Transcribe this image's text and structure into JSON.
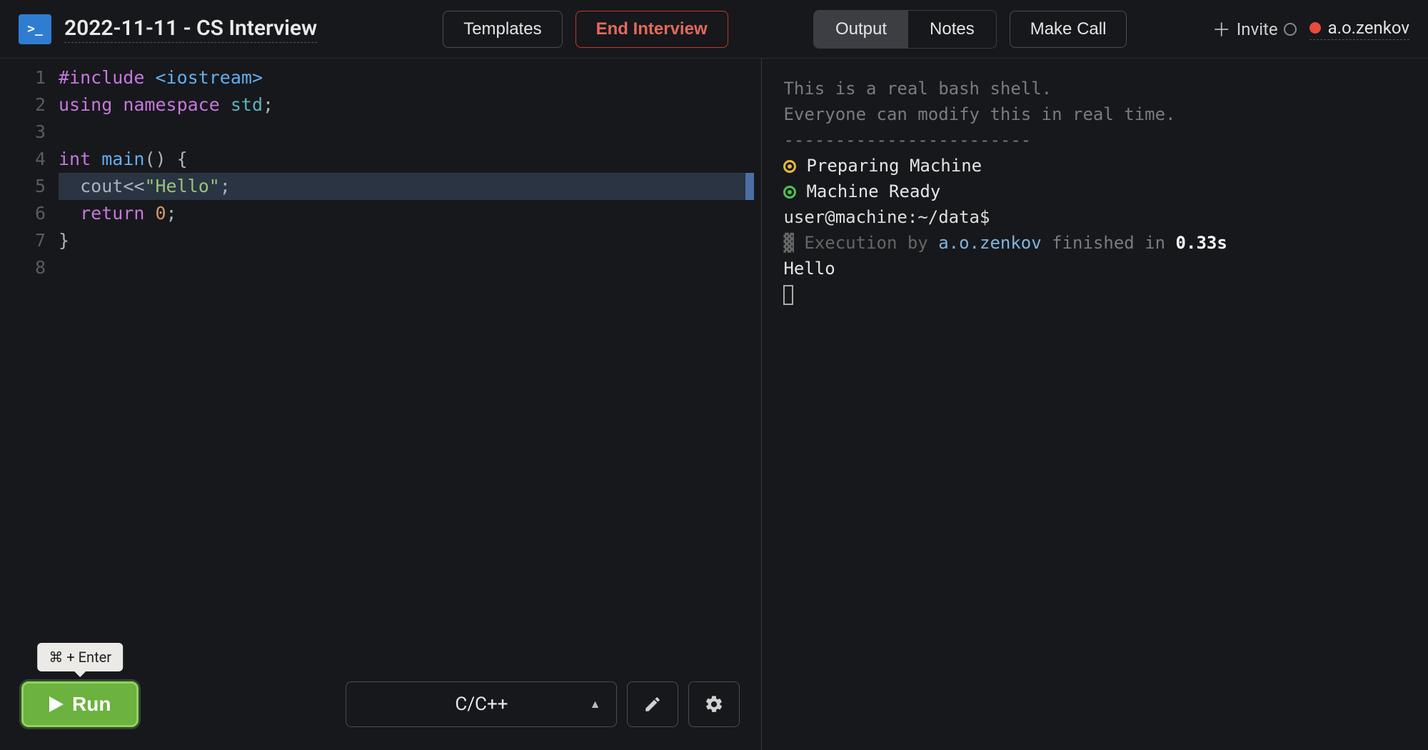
{
  "header": {
    "logo_text": ">_",
    "title": "2022-11-11 - CS Interview",
    "templates_label": "Templates",
    "end_label": "End Interview",
    "tabs": {
      "output": "Output",
      "notes": "Notes"
    },
    "make_call_label": "Make Call",
    "invite_label": "Invite",
    "username": "a.o.zenkov"
  },
  "editor": {
    "line_numbers": [
      "1",
      "2",
      "3",
      "4",
      "5",
      "6",
      "7",
      "8"
    ],
    "highlighted_line_index": 4,
    "tokens": {
      "l1_pp": "#include",
      "l1_inc": "<iostream>",
      "l2_kw": "using",
      "l2_kw2": "namespace",
      "l2_ns": "std",
      "l4_ty": "int",
      "l4_fn": "main",
      "l5_id": "cout",
      "l5_str": "\"Hello\"",
      "l6_kw": "return",
      "l6_num": "0"
    }
  },
  "footer": {
    "tooltip": "⌘ + Enter",
    "run_label": "Run",
    "language": "C/C++"
  },
  "terminal": {
    "intro1": "This is a real bash shell.",
    "intro2": "Everyone can modify this in real time.",
    "divider": "------------------------",
    "preparing": "Preparing Machine",
    "ready": "Machine Ready",
    "prompt": "user@machine:~/data$",
    "exec_prefix": "▓ Execution by ",
    "exec_user": "a.o.zenkov",
    "exec_mid": " finished in ",
    "exec_time": "0.33s",
    "output_line": "Hello"
  }
}
